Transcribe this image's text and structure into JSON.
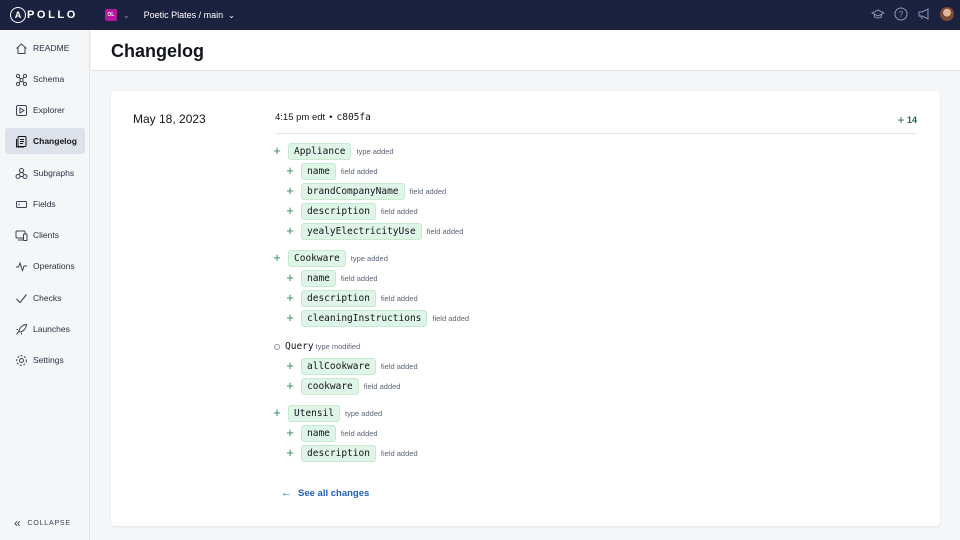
{
  "topbar": {
    "logo_initial": "A",
    "logo_rest": "POLLO",
    "org_initials": "OL",
    "graph_name": "Poetic Plates / main"
  },
  "sidebar": {
    "items": [
      {
        "label": "README",
        "icon": "house-icon"
      },
      {
        "label": "Schema",
        "icon": "schema-icon"
      },
      {
        "label": "Explorer",
        "icon": "play-icon"
      },
      {
        "label": "Changelog",
        "icon": "changelog-icon",
        "active": true
      },
      {
        "label": "Subgraphs",
        "icon": "subgraphs-icon"
      },
      {
        "label": "Fields",
        "icon": "fields-icon"
      },
      {
        "label": "Clients",
        "icon": "clients-icon"
      },
      {
        "label": "Operations",
        "icon": "operations-icon"
      },
      {
        "label": "Checks",
        "icon": "check-icon"
      },
      {
        "label": "Launches",
        "icon": "rocket-icon"
      },
      {
        "label": "Settings",
        "icon": "gear-icon"
      }
    ],
    "collapse_label": "COLLAPSE"
  },
  "header": {
    "title": "Changelog"
  },
  "changelog": {
    "date": "May 18, 2023",
    "time": "4:15 pm edt",
    "separator": "•",
    "commit": "c805fa",
    "count": "14",
    "changes": [
      {
        "level": 0,
        "mark": "+",
        "name": "Appliance",
        "desc": "type added"
      },
      {
        "level": 1,
        "mark": "+",
        "name": "name",
        "desc": "field added"
      },
      {
        "level": 1,
        "mark": "+",
        "name": "brandCompanyName",
        "desc": "field added"
      },
      {
        "level": 1,
        "mark": "+",
        "name": "description",
        "desc": "field added"
      },
      {
        "level": 1,
        "mark": "+",
        "name": "yealyElectricityUse",
        "desc": "field added"
      },
      {
        "level": 0,
        "mark": "+",
        "name": "Cookware",
        "desc": "type added"
      },
      {
        "level": 1,
        "mark": "+",
        "name": "name",
        "desc": "field added"
      },
      {
        "level": 1,
        "mark": "+",
        "name": "description",
        "desc": "field added"
      },
      {
        "level": 1,
        "mark": "+",
        "name": "cleaningInstructions",
        "desc": "field added"
      },
      {
        "level": 0,
        "mark": "o",
        "name": "Query",
        "desc": "type modified"
      },
      {
        "level": 1,
        "mark": "+",
        "name": "allCookware",
        "desc": "field added"
      },
      {
        "level": 1,
        "mark": "+",
        "name": "cookware",
        "desc": "field added"
      },
      {
        "level": 0,
        "mark": "+",
        "name": "Utensil",
        "desc": "type added"
      },
      {
        "level": 1,
        "mark": "+",
        "name": "name",
        "desc": "field added"
      },
      {
        "level": 1,
        "mark": "+",
        "name": "description",
        "desc": "field added"
      }
    ],
    "see_all_label": "See all changes"
  },
  "colors": {
    "topbar": "#1b2240",
    "added_tag_bg": "#dff5e7",
    "plus_green": "#2e8b57",
    "link_blue": "#1f5fb5"
  }
}
